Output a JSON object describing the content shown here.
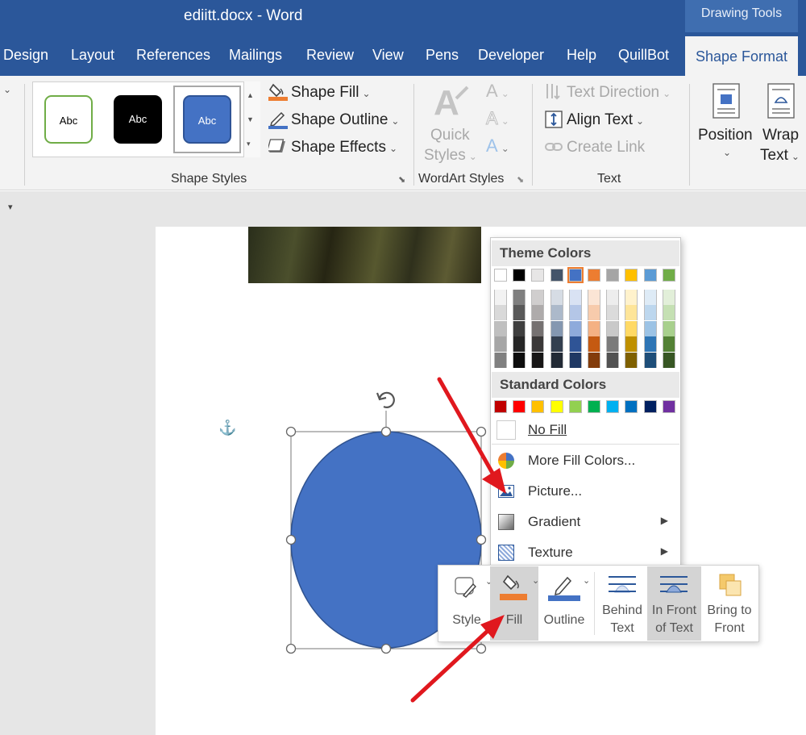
{
  "window": {
    "title": "ediitt.docx  -  Word",
    "contextual_group": "Drawing Tools"
  },
  "tabs": [
    "Design",
    "Layout",
    "References",
    "Mailings",
    "Review",
    "View",
    "Pens",
    "Developer",
    "Help",
    "QuillBot",
    "Shape Format"
  ],
  "ribbon": {
    "shape_styles": {
      "gallery": [
        "Abc",
        "Abc",
        "Abc"
      ],
      "shape_fill": "Shape Fill",
      "shape_outline": "Shape Outline",
      "shape_effects": "Shape Effects",
      "label": "Shape Styles"
    },
    "wordart_styles": {
      "quick_styles_line1": "Quick",
      "quick_styles_line2": "Styles",
      "label": "WordArt Styles"
    },
    "text": {
      "text_direction": "Text Direction",
      "align_text": "Align Text",
      "create_link": "Create Link",
      "label": "Text"
    },
    "arrange": {
      "position": "Position",
      "wrap_line1": "Wrap",
      "wrap_line2": "Text"
    }
  },
  "fill_menu": {
    "theme_colors_heading": "Theme Colors",
    "standard_colors_heading": "Standard Colors",
    "theme_colors": [
      [
        "#ffffff",
        "#f2f2f2",
        "#d9d9d9",
        "#bfbfbf",
        "#a6a6a6",
        "#808080"
      ],
      [
        "#000000",
        "#7f7f7f",
        "#595959",
        "#3f3f3f",
        "#262626",
        "#0d0d0d"
      ],
      [
        "#e7e6e6",
        "#d0cece",
        "#aeabab",
        "#757171",
        "#3a3838",
        "#171616"
      ],
      [
        "#44546a",
        "#d6dce4",
        "#acb9ca",
        "#8497b0",
        "#333f4f",
        "#222a35"
      ],
      [
        "#4472c4",
        "#d9e2f3",
        "#b4c6e7",
        "#8eaadb",
        "#2f5496",
        "#1f3864"
      ],
      [
        "#ed7d31",
        "#fbe5d5",
        "#f7cbac",
        "#f4b183",
        "#c55a11",
        "#833c0b"
      ],
      [
        "#a5a5a5",
        "#ededed",
        "#dbdbdb",
        "#c9c9c9",
        "#7b7b7b",
        "#525252"
      ],
      [
        "#ffc000",
        "#fff2cc",
        "#fee599",
        "#ffd965",
        "#bf9000",
        "#7f6000"
      ],
      [
        "#5b9bd5",
        "#deebf6",
        "#bdd7ee",
        "#9cc3e5",
        "#2e75b5",
        "#1e4e79"
      ],
      [
        "#70ad47",
        "#e2efd9",
        "#c5e0b3",
        "#a8d08d",
        "#538135",
        "#375623"
      ]
    ],
    "standard_colors": [
      "#c00000",
      "#ff0000",
      "#ffc000",
      "#ffff00",
      "#92d050",
      "#00b050",
      "#00b0f0",
      "#0070c0",
      "#002060",
      "#7030a0"
    ],
    "no_fill": "No Fill",
    "more_fill_colors": "More Fill Colors...",
    "picture": "Picture...",
    "gradient": "Gradient",
    "texture": "Texture"
  },
  "mini_toolbar": {
    "style": "Style",
    "fill": "Fill",
    "outline": "Outline",
    "behind_line1": "Behind",
    "behind_line2": "Text",
    "infront_line1": "In Front",
    "infront_line2": "of Text",
    "bring_line1": "Bring to",
    "bring_line2": "Front"
  },
  "colors": {
    "title_bar": "#2b579a",
    "shape_fill": "#4472c4",
    "arrow": "#e0181e"
  }
}
